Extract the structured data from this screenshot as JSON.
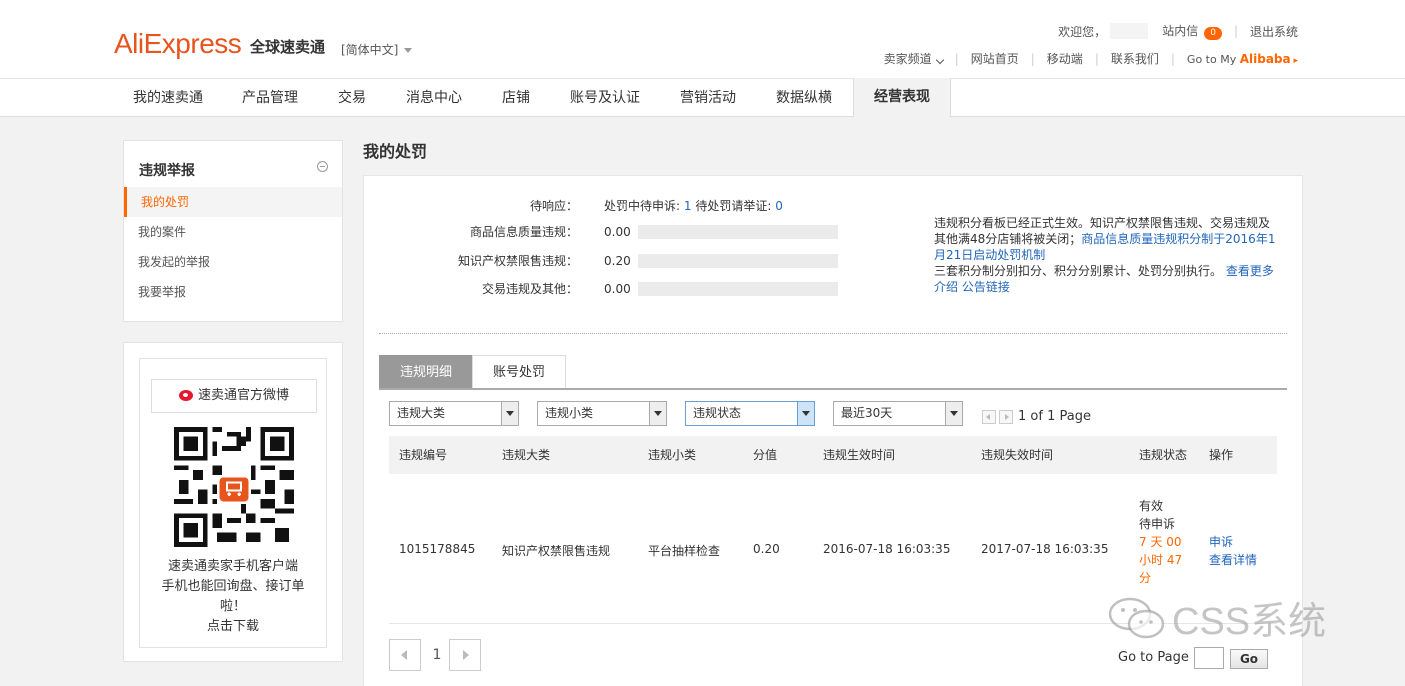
{
  "brand": {
    "logo": "AliExpress",
    "subtitle": "全球速卖通",
    "lang": "[简体中文]"
  },
  "topbar": {
    "welcome": "欢迎您，",
    "inbox": "站内信",
    "inbox_count": "0",
    "logout": "退出系统",
    "links": [
      "卖家频道",
      "网站首页",
      "移动端",
      "联系我们"
    ],
    "goto_prefix": "Go to My",
    "goto_brand": "Alibaba"
  },
  "nav": {
    "items": [
      "我的速卖通",
      "产品管理",
      "交易",
      "消息中心",
      "店铺",
      "账号及认证",
      "营销活动",
      "数据纵横",
      "经营表现"
    ],
    "active": "经营表现"
  },
  "sidebar": {
    "title": "违规举报",
    "items": [
      "我的处罚",
      "我的案件",
      "我发起的举报",
      "我要举报"
    ],
    "active": "我的处罚"
  },
  "promo": {
    "weibo": "速卖通官方微博",
    "lines": [
      "速卖通卖家手机客户端",
      "手机也能回询盘、接订单",
      "啦！",
      "点击下载"
    ]
  },
  "main": {
    "title": "我的处罚",
    "pending": {
      "label": "待响应：",
      "appeal_text": "处罚中待申诉:",
      "appeal_count": "1",
      "evidence_text": "待处罚请举证:",
      "evidence_count": "0"
    },
    "stats": [
      {
        "label": "商品信息质量违规：",
        "value": "0.00"
      },
      {
        "label": "知识产权禁限售违规：",
        "value": "0.20"
      },
      {
        "label": "交易违规及其他：",
        "value": "0.00"
      }
    ],
    "notice": {
      "part1": "违规积分看板已经正式生效。知识产权禁限售违规、交易违规及其他满48分店铺将被关闭；",
      "link1": "商品信息质量违规积分制于2016年1月21日启动处罚机制",
      "part2": "三套积分制分别扣分、积分分别累计、处罚分别执行。",
      "link2": "查看更多介绍",
      "link3": "公告链接"
    },
    "tabs": [
      "违规明细",
      "账号处罚"
    ],
    "active_tab": "违规明细",
    "filters": [
      "违规大类",
      "违规小类",
      "违规状态",
      "最近30天"
    ],
    "pager_top": "1 of 1 Page",
    "table": {
      "headers": [
        "违规编号",
        "违规大类",
        "违规小类",
        "分值",
        "违规生效时间",
        "违规失效时间",
        "违规状态",
        "操作"
      ],
      "rows": [
        {
          "id": "1015178845",
          "category": "知识产权禁限售违规",
          "subcategory": "平台抽样检查",
          "score": "0.20",
          "start": "2016-07-18 16:03:35",
          "end": "2017-07-18 16:03:35",
          "status1": "有效",
          "status2": "待申诉",
          "countdown_lines": [
            "7 天 00",
            "小时 47",
            "分"
          ],
          "actions": [
            "申诉",
            "查看详情"
          ]
        }
      ]
    },
    "pager": {
      "page": "1",
      "goto_label": "Go to Page",
      "go": "Go"
    }
  },
  "watermark": "CSS系统",
  "colors": {
    "brand": "#e8541e",
    "accent": "#ff6600",
    "link": "#2266bb"
  }
}
